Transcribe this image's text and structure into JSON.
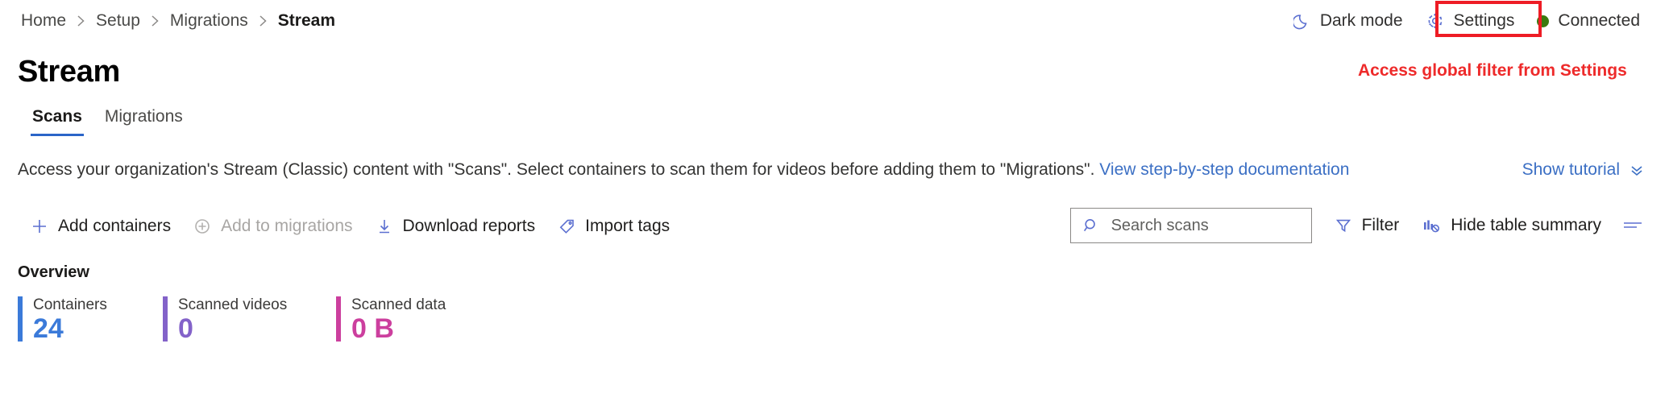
{
  "breadcrumb": {
    "items": [
      {
        "label": "Home",
        "current": false
      },
      {
        "label": "Setup",
        "current": false
      },
      {
        "label": "Migrations",
        "current": false
      },
      {
        "label": "Stream",
        "current": true
      }
    ]
  },
  "topbar": {
    "dark_mode_label": "Dark mode",
    "dark_mode_icon": "moon-icon",
    "settings_label": "Settings",
    "settings_icon": "gear-icon",
    "connection_label": "Connected",
    "connection_status_color": "#3b7a0f"
  },
  "annotation": {
    "text": "Access global filter from Settings",
    "color": "#ee2a2a",
    "box_color": "#ee1c25",
    "target": "settings-button"
  },
  "page": {
    "title": "Stream"
  },
  "tabs": [
    {
      "label": "Scans",
      "active": true
    },
    {
      "label": "Migrations",
      "active": false
    }
  ],
  "description": {
    "text_before": "Access your organization's Stream (Classic) content with \"Scans\". Select containers to scan them for videos before adding them to \"Migrations\". ",
    "link_text": "View step-by-step documentation",
    "show_tutorial_label": "Show tutorial",
    "show_tutorial_icon": "double-chevron-down-icon"
  },
  "toolbar": {
    "left_actions": [
      {
        "label": "Add containers",
        "icon": "plus-icon",
        "disabled": false
      },
      {
        "label": "Add to migrations",
        "icon": "circle-plus-icon",
        "disabled": true
      },
      {
        "label": "Download reports",
        "icon": "download-icon",
        "disabled": false
      },
      {
        "label": "Import tags",
        "icon": "tag-icon",
        "disabled": false
      }
    ],
    "search": {
      "placeholder": "Search scans",
      "value": "",
      "icon": "search-icon"
    },
    "right_actions": [
      {
        "label": "Filter",
        "icon": "funnel-icon"
      },
      {
        "label": "Hide table summary",
        "icon": "chart-off-icon"
      }
    ],
    "options_icon": "list-options-icon"
  },
  "overview": {
    "title": "Overview",
    "stats": [
      {
        "label": "Containers",
        "value": "24",
        "color": "#3b7ad9"
      },
      {
        "label": "Scanned videos",
        "value": "0",
        "color": "#8362c9"
      },
      {
        "label": "Scanned data",
        "value": "0 B",
        "color": "#cc3f9e"
      }
    ]
  }
}
